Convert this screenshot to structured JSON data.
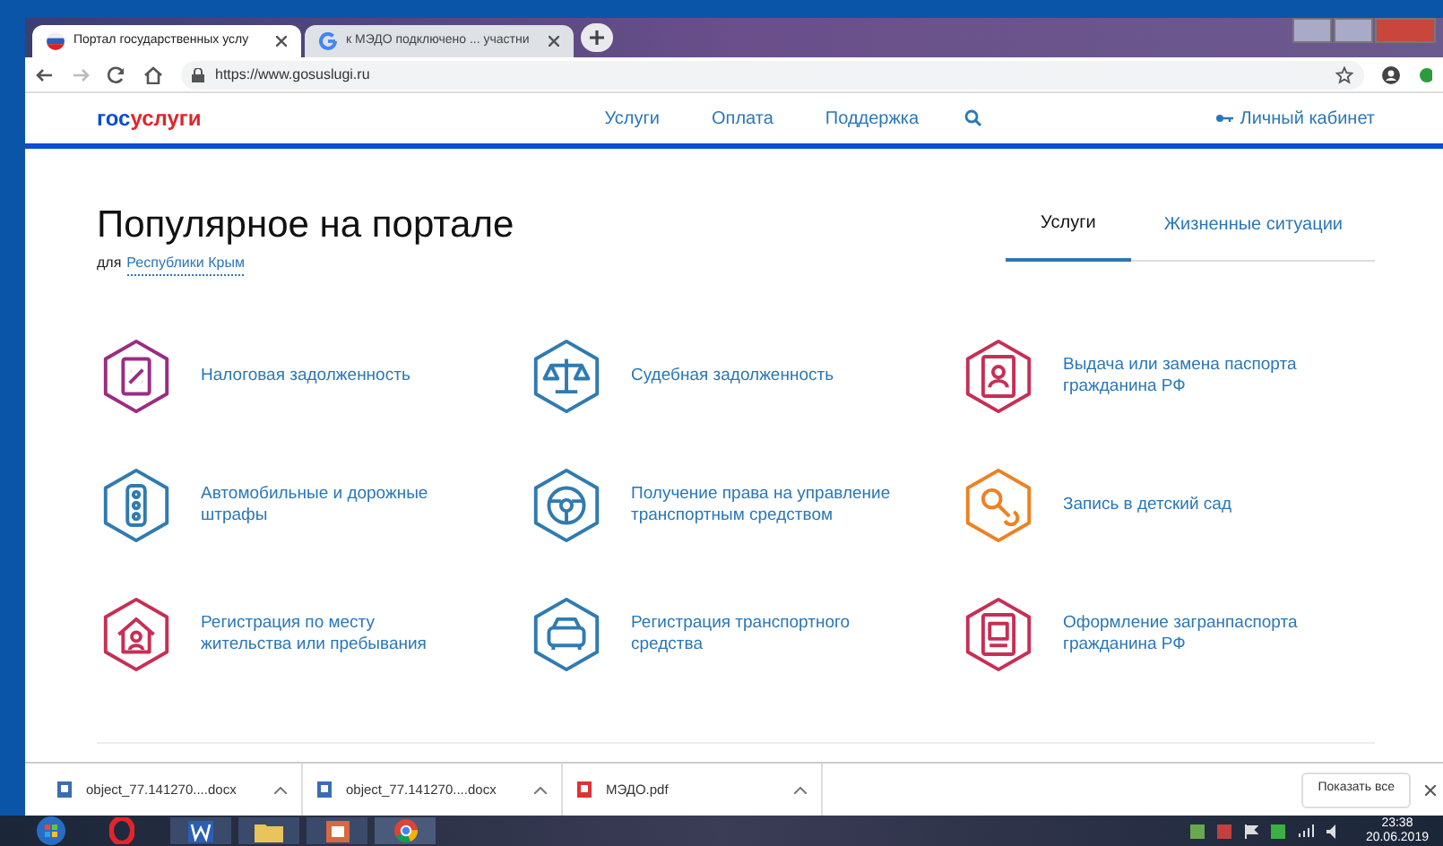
{
  "browser": {
    "tabs": [
      {
        "title": "Портал государственных услу",
        "selected": true
      },
      {
        "title": "к МЭДО подключено ... участни",
        "selected": false
      }
    ],
    "url": "https://www.gosuslugi.ru"
  },
  "site": {
    "logo_left": "гос",
    "logo_right": "услуги",
    "nav": [
      "Услуги",
      "Оплата",
      "Поддержка"
    ],
    "account": "Личный кабинет"
  },
  "section": {
    "title": "Популярное на портале",
    "region_prefix": "для",
    "region": "Республики Крым",
    "tabs": [
      {
        "label": "Услуги",
        "selected": true
      },
      {
        "label": "Жизненные ситуации",
        "selected": false
      }
    ]
  },
  "services": [
    {
      "label": "Налоговая задолженность",
      "color": "#9b2c83"
    },
    {
      "label": "Судебная задолженность",
      "color": "#2f7bb1"
    },
    {
      "label": "Выдача или замена паспорта гражданина РФ",
      "color": "#c72f55"
    },
    {
      "label": "Автомобильные и дорожные штрафы",
      "color": "#2f7bb1"
    },
    {
      "label": "Получение права на управление транспортным средством",
      "color": "#2f7bb1"
    },
    {
      "label": "Запись в детский сад",
      "color": "#ee8122"
    },
    {
      "label": "Регистрация по месту жительства или пребывания",
      "color": "#c72f55"
    },
    {
      "label": "Регистрация транспортного средства",
      "color": "#2f7bb1"
    },
    {
      "label": "Оформление загранпаспорта гражданина РФ",
      "color": "#c72f55"
    }
  ],
  "downloads": {
    "items": [
      {
        "name": "object_77.141270....docx",
        "kind": "doc"
      },
      {
        "name": "object_77.141270....docx",
        "kind": "doc"
      },
      {
        "name": "МЭДО.pdf",
        "kind": "pdf"
      }
    ],
    "show_all": "Показать все"
  },
  "taskbar": {
    "time": "23:38",
    "date": "20.06.2019"
  }
}
